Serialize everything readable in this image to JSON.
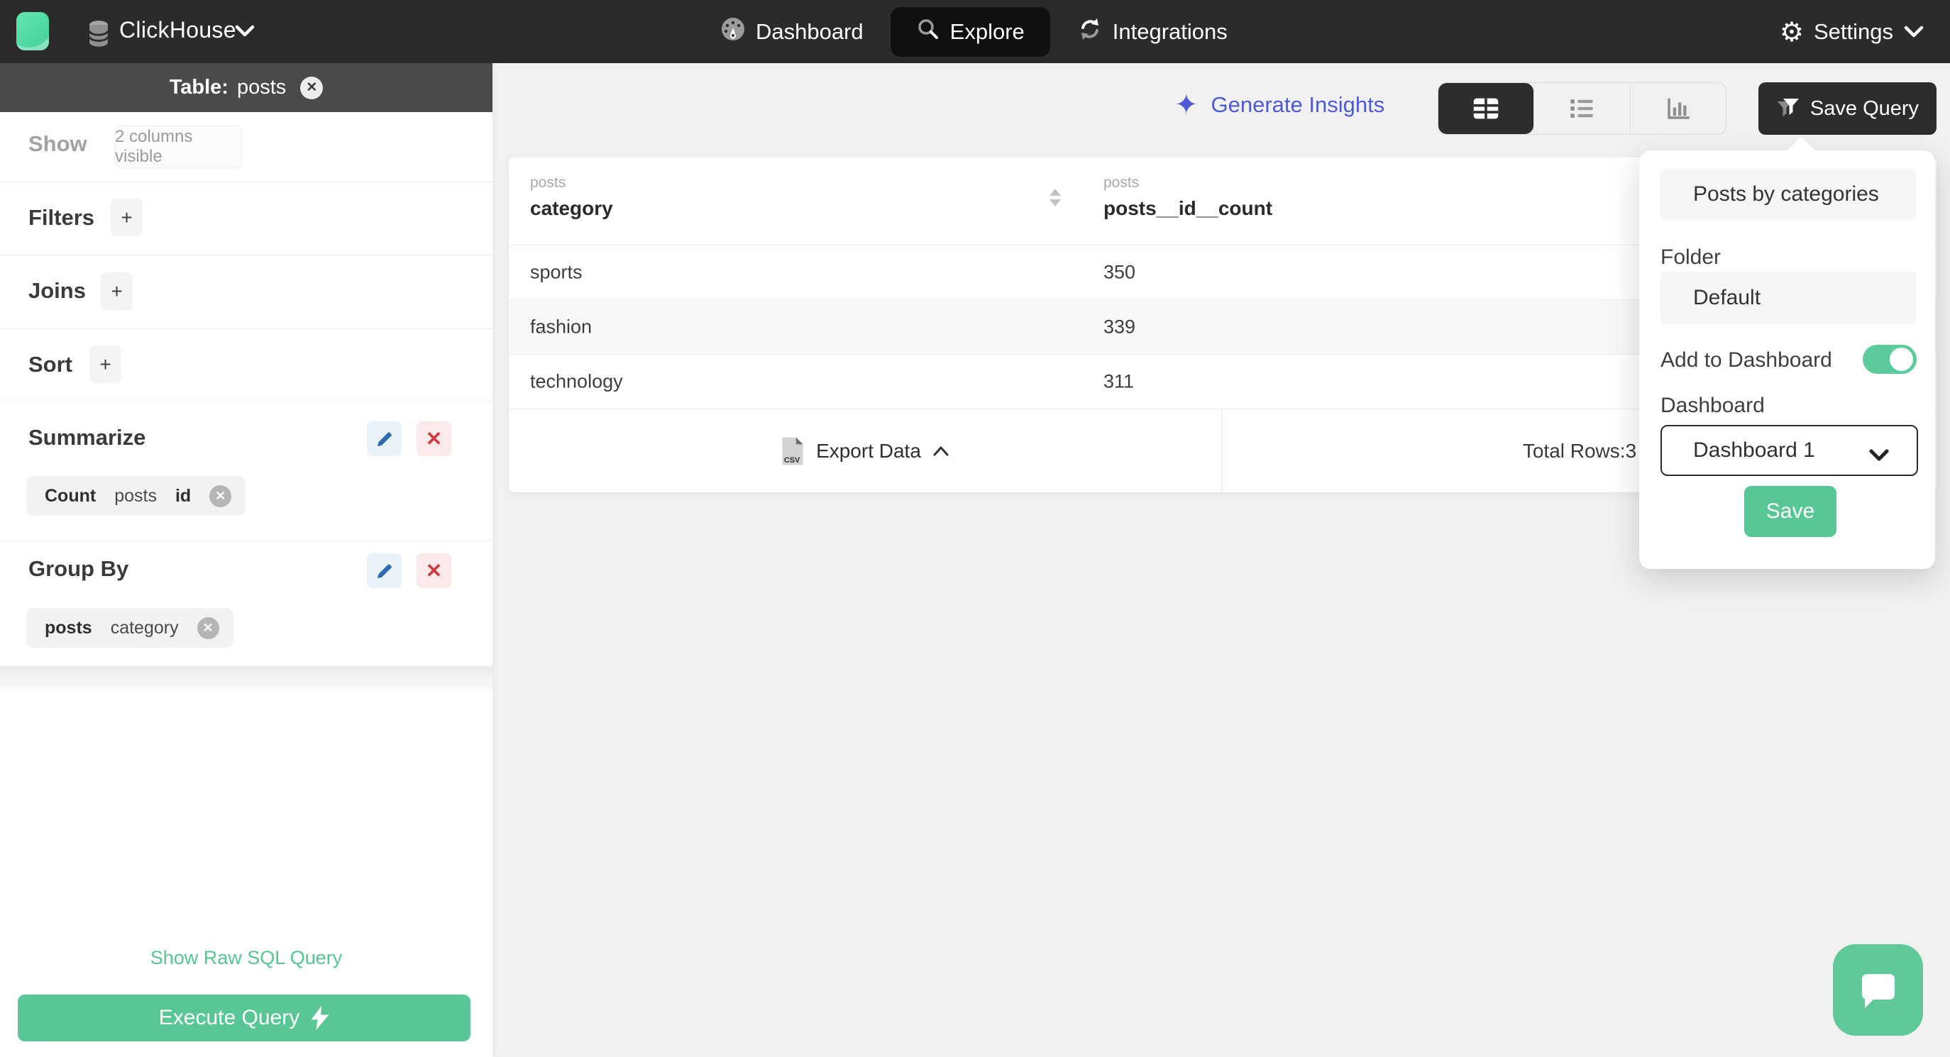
{
  "nav": {
    "brand": "ClickHouse",
    "items": [
      {
        "label": "Dashboard"
      },
      {
        "label": "Explore"
      },
      {
        "label": "Integrations"
      }
    ],
    "settings_label": "Settings"
  },
  "sidebar": {
    "table_label": "Table:",
    "table_name": "posts",
    "show_label": "Show",
    "show_value": "2 columns visible",
    "filters_label": "Filters",
    "joins_label": "Joins",
    "sort_label": "Sort",
    "summarize_label": "Summarize",
    "summarize_chip": {
      "agg": "Count",
      "table": "posts",
      "column": "id"
    },
    "group_by_label": "Group By",
    "group_by_chip": {
      "table": "posts",
      "column": "category"
    },
    "plus_label": "+",
    "close_x": "✕",
    "raw_sql_link": "Show Raw SQL Query",
    "execute_button": "Execute Query"
  },
  "toolbar": {
    "generate_insights": "Generate Insights",
    "sparkle_glyph": "✦",
    "save_query": "Save Query"
  },
  "table": {
    "columns": [
      {
        "group": "posts",
        "name": "category"
      },
      {
        "group": "posts",
        "name": "posts__id__count"
      }
    ],
    "rows": [
      [
        "sports",
        "350"
      ],
      [
        "fashion",
        "339"
      ],
      [
        "technology",
        "311"
      ]
    ],
    "export_label": "Export Data",
    "total_rows_label": "Total Rows:",
    "total_rows_value": "3"
  },
  "save_popover": {
    "name_value": "Posts by categories",
    "folder_label": "Folder",
    "folder_value": "Default",
    "add_to_dashboard_label": "Add to Dashboard",
    "toggle_state": "on",
    "dashboard_label": "Dashboard",
    "dashboard_value": "Dashboard 1",
    "save_label": "Save"
  },
  "colors": {
    "accent_green": "#58c795",
    "nav_dark": "#2b2b2b",
    "insights_blue": "#4e5bd3",
    "delete_red": "#cf3a40",
    "edit_blue": "#2d6cae"
  }
}
